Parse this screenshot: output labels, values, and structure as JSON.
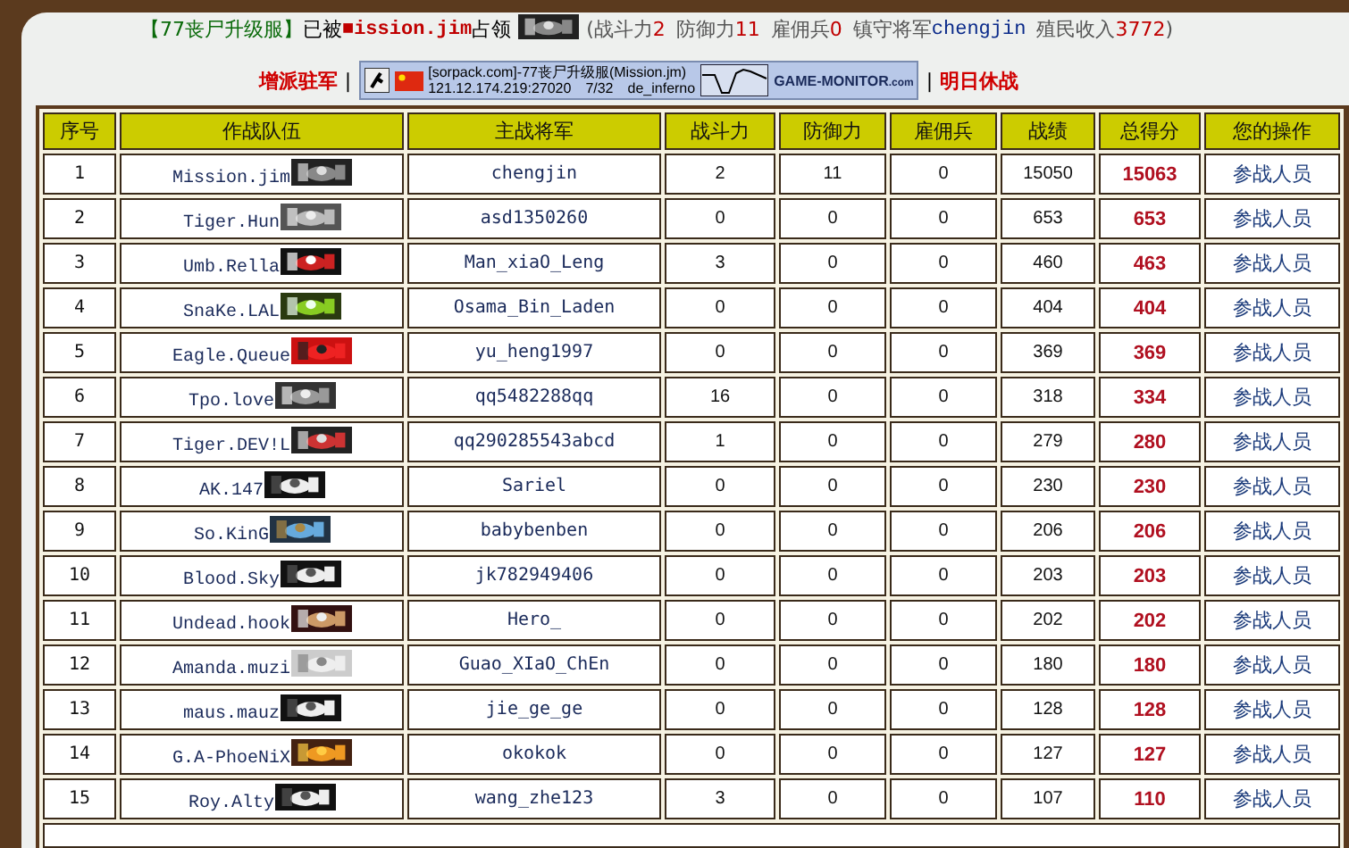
{
  "header": {
    "server": "【77丧尸升级服】",
    "taken_by": "已被",
    "occupier": "■ission.jim",
    "occupied": "占领",
    "stats_open": "(",
    "stats": [
      {
        "label": "战斗力",
        "value": "2"
      },
      {
        "label": "防御力",
        "value": "11"
      },
      {
        "label": "雇佣兵",
        "value": "0"
      }
    ],
    "general_label": "镇守将军",
    "general": "chengjin",
    "income_label": "殖民收入",
    "income": "3772",
    "stats_close": ")"
  },
  "actions": {
    "reinforce": "增派驻军",
    "separator_left": "|",
    "separator_right": "|",
    "truce": "明日休战"
  },
  "server_banner": {
    "name": "[sorpack.com]-77丧尸升级服(Mission.jm)",
    "address": "121.12.174.219:27020",
    "players": "7/32",
    "map": "de_inferno",
    "brand": "GAME-MONITOR",
    "brand_suffix": ".com"
  },
  "table": {
    "columns": [
      "序号",
      "作战队伍",
      "主战将军",
      "战斗力",
      "防御力",
      "雇佣兵",
      "战绩",
      "总得分",
      "您的操作"
    ],
    "rows": [
      {
        "no": "1",
        "team": "Mission.jim",
        "general": "chengjin",
        "attack": "2",
        "defense": "11",
        "mercenaries": "0",
        "record": "15050",
        "total": "15063",
        "action": "参战人员"
      },
      {
        "no": "2",
        "team": "Tiger.Hun",
        "general": "asd1350260",
        "attack": "0",
        "defense": "0",
        "mercenaries": "0",
        "record": "653",
        "total": "653",
        "action": "参战人员"
      },
      {
        "no": "3",
        "team": "Umb.Rella",
        "general": "Man_xiaO_Leng",
        "attack": "3",
        "defense": "0",
        "mercenaries": "0",
        "record": "460",
        "total": "463",
        "action": "参战人员"
      },
      {
        "no": "4",
        "team": "SnaKe.LAL",
        "general": "Osama_Bin_Laden",
        "attack": "0",
        "defense": "0",
        "mercenaries": "0",
        "record": "404",
        "total": "404",
        "action": "参战人员"
      },
      {
        "no": "5",
        "team": "Eagle.Queue",
        "general": "yu_heng1997",
        "attack": "0",
        "defense": "0",
        "mercenaries": "0",
        "record": "369",
        "total": "369",
        "action": "参战人员"
      },
      {
        "no": "6",
        "team": "Tpo.love",
        "general": "qq5482288qq",
        "attack": "16",
        "defense": "0",
        "mercenaries": "0",
        "record": "318",
        "total": "334",
        "action": "参战人员"
      },
      {
        "no": "7",
        "team": "Tiger.DEV!L",
        "general": "qq290285543abcd",
        "attack": "1",
        "defense": "0",
        "mercenaries": "0",
        "record": "279",
        "total": "280",
        "action": "参战人员"
      },
      {
        "no": "8",
        "team": "AK.147",
        "general": "Sariel",
        "attack": "0",
        "defense": "0",
        "mercenaries": "0",
        "record": "230",
        "total": "230",
        "action": "参战人员"
      },
      {
        "no": "9",
        "team": "So.KinG",
        "general": "babybenben",
        "attack": "0",
        "defense": "0",
        "mercenaries": "0",
        "record": "206",
        "total": "206",
        "action": "参战人员"
      },
      {
        "no": "10",
        "team": "Blood.Sky",
        "general": "jk782949406",
        "attack": "0",
        "defense": "0",
        "mercenaries": "0",
        "record": "203",
        "total": "203",
        "action": "参战人员"
      },
      {
        "no": "11",
        "team": "Undead.hook",
        "general": "Hero_",
        "attack": "0",
        "defense": "0",
        "mercenaries": "0",
        "record": "202",
        "total": "202",
        "action": "参战人员"
      },
      {
        "no": "12",
        "team": "Amanda.muzi",
        "general": "Guao_XIaO_ChEn",
        "attack": "0",
        "defense": "0",
        "mercenaries": "0",
        "record": "180",
        "total": "180",
        "action": "参战人员"
      },
      {
        "no": "13",
        "team": "maus.mauz",
        "general": "jie_ge_ge",
        "attack": "0",
        "defense": "0",
        "mercenaries": "0",
        "record": "128",
        "total": "128",
        "action": "参战人员"
      },
      {
        "no": "14",
        "team": "G.A-PhoeNiX",
        "general": "okokok",
        "attack": "0",
        "defense": "0",
        "mercenaries": "0",
        "record": "127",
        "total": "127",
        "action": "参战人员"
      },
      {
        "no": "15",
        "team": "Roy.Alty",
        "general": "wang_zhe123",
        "attack": "3",
        "defense": "0",
        "mercenaries": "0",
        "record": "107",
        "total": "110",
        "action": "参战人员"
      }
    ]
  }
}
